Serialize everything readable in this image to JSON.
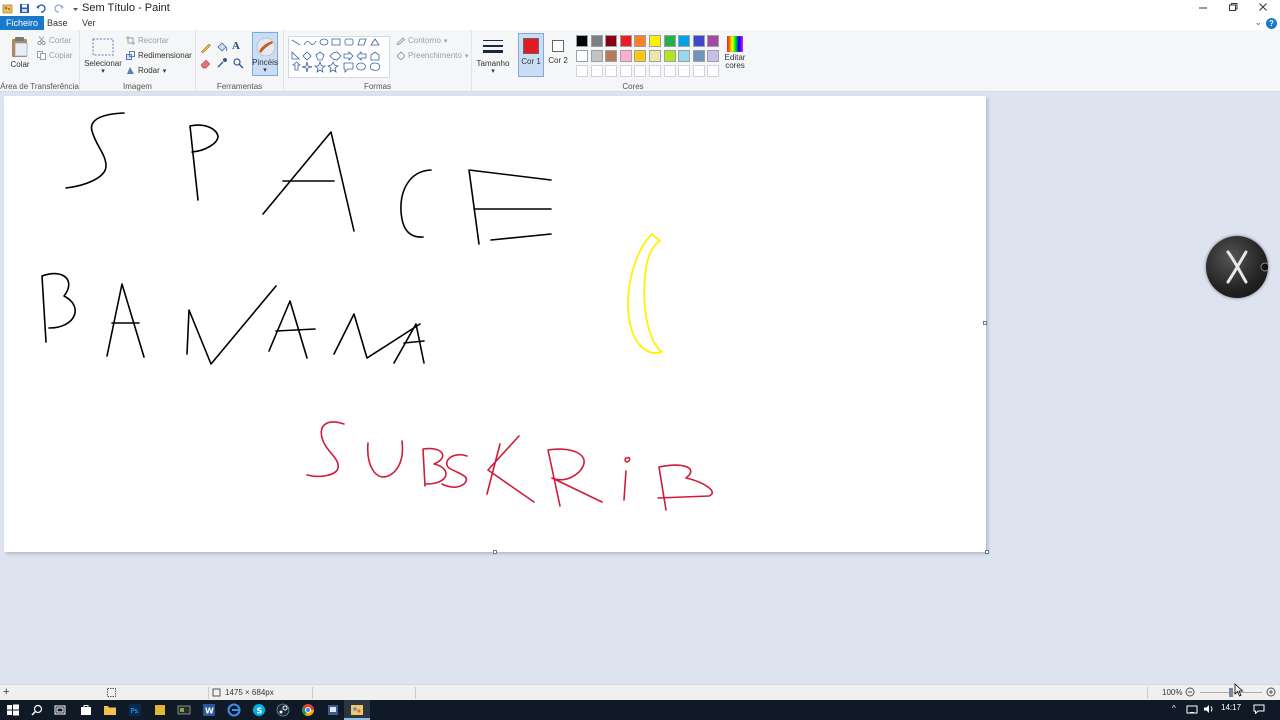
{
  "window": {
    "title": "Sem Título - Paint",
    "minimize_icon": "minimize-icon",
    "restore_icon": "restore-icon",
    "close_icon": "close-icon"
  },
  "menu": {
    "tabs": [
      "Ficheiro",
      "Base",
      "Ver"
    ],
    "active_tab": "Ficheiro"
  },
  "ribbon": {
    "clipboard": {
      "label": "Área de Transferência",
      "paste": "Colar",
      "cut": "Cortar",
      "copy": "Copiar"
    },
    "image": {
      "label": "Imagem",
      "select": "Selecionar",
      "crop": "Recortar",
      "resize": "Redimensionar",
      "rotate": "Rodar"
    },
    "tools": {
      "label": "Ferramentas",
      "brushes": "Pincéis"
    },
    "shapes": {
      "label": "Formas",
      "outline": "Contorno",
      "fill": "Preenchimento"
    },
    "size": {
      "label": "Tamanho"
    },
    "colors": {
      "label": "Cores",
      "color1": "Cor 1",
      "color2": "Cor 2",
      "color1_value": "#e31b23",
      "color2_value": "#ffffff",
      "edit_colors": "Editar cores",
      "palette_row1": [
        "#000000",
        "#7f7f7f",
        "#880015",
        "#ed1c24",
        "#ff7f27",
        "#fff200",
        "#22b14c",
        "#00a2e8",
        "#3f48cc",
        "#a349a4"
      ],
      "palette_row2": [
        "#ffffff",
        "#c3c3c3",
        "#b97a57",
        "#ffaec9",
        "#ffc90e",
        "#efe4b0",
        "#b5e61d",
        "#99d9ea",
        "#7092be",
        "#c8bfe7"
      ]
    }
  },
  "canvas": {
    "handwritten_line1": "SPACE",
    "handwritten_line2": "BANANA",
    "handwritten_line3": "SUBSKRIB",
    "ink_black": "#000000",
    "ink_red": "#d01c3a",
    "ink_yellow": "#fff200"
  },
  "statusbar": {
    "canvas_size": "1475 × 684px",
    "zoom": "100%"
  },
  "taskbar": {
    "time": "14:17"
  }
}
